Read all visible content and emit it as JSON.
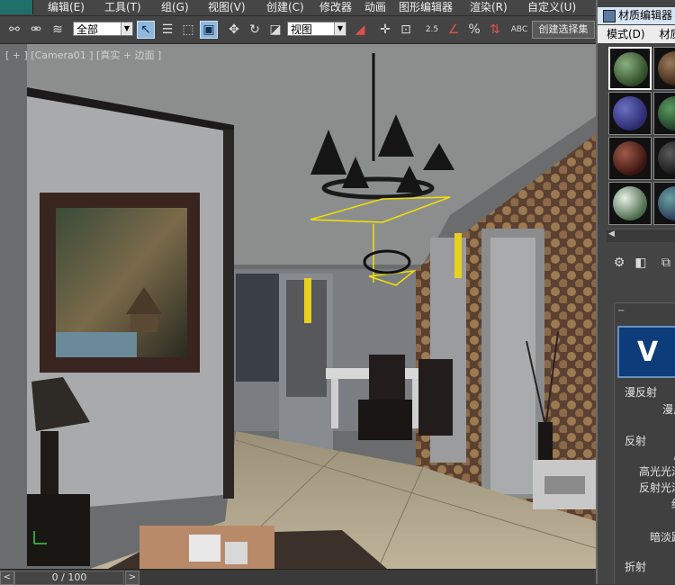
{
  "menubar": {
    "items": [
      "编辑(E)",
      "工具(T)",
      "组(G)",
      "视图(V)",
      "创建(C)",
      "修改器",
      "动画",
      "图形编辑器",
      "渲染(R)",
      "自定义(U)"
    ]
  },
  "toolbar": {
    "selection_filter": "全部",
    "reference_coord": "视图",
    "create_selection_set": "创建选择集",
    "percent_snap": "2.5"
  },
  "viewport": {
    "label": "[ + ] [Camera01 ] [真实 + 边面 ]"
  },
  "timebar": {
    "frame_counter": "0 / 100",
    "prev": "<",
    "next": ">"
  },
  "material_editor": {
    "title": "材质编辑器",
    "menu_mode": "模式(D)",
    "menu_material": "材质",
    "vray_text": "V",
    "rollouts": {
      "diffuse_header": "漫反射",
      "diffuse_label": "漫反",
      "reflection_header": "反射",
      "reflect_label": "反",
      "hilight_gloss": "高光光泽",
      "refl_gloss": "反射光泽",
      "subdivs": "细",
      "dim_distance": "暗淡距",
      "refraction_header": "折射"
    }
  },
  "icons": {
    "link": "link-icon",
    "unlink": "unlink-icon",
    "bind_space_warp": "bind-space-warp-icon",
    "select": "select-object-icon",
    "select_by_name": "select-by-name-icon",
    "rect_region": "rectangular-selection-icon",
    "window_crossing": "window-crossing-icon",
    "move": "move-icon",
    "rotate": "rotate-icon",
    "scale": "scale-icon"
  }
}
